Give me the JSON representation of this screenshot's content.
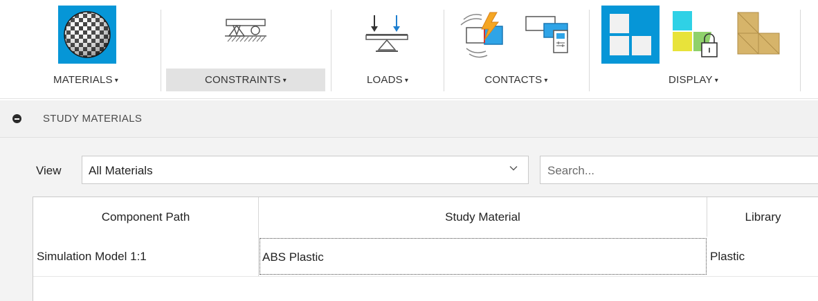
{
  "toolbar": {
    "groups": [
      {
        "label": "MATERIALS",
        "icon": "material-sphere-icon"
      },
      {
        "label": "CONSTRAINTS",
        "icon": "fixed-constraint-icon",
        "active": true
      },
      {
        "label": "LOADS",
        "icon": "load-arrows-icon"
      },
      {
        "label": "CONTACTS",
        "icon": "contact-icon"
      },
      {
        "label": "DISPLAY",
        "icon": "display-icon"
      }
    ],
    "caret": "▾",
    "colors": {
      "accent": "#0696d7",
      "gold": "#d6b46a",
      "yellow": "#e8e33a",
      "green": "#8fd16b",
      "cyan": "#2fd1e6"
    }
  },
  "panel": {
    "title": "STUDY MATERIALS",
    "view_label": "View",
    "view_value": "All Materials",
    "search_placeholder": "Search..."
  },
  "table": {
    "headers": [
      "Component Path",
      "Study Material",
      "Library"
    ],
    "rows": [
      [
        "Simulation Model 1:1",
        "ABS Plastic",
        "Plastic"
      ]
    ]
  }
}
